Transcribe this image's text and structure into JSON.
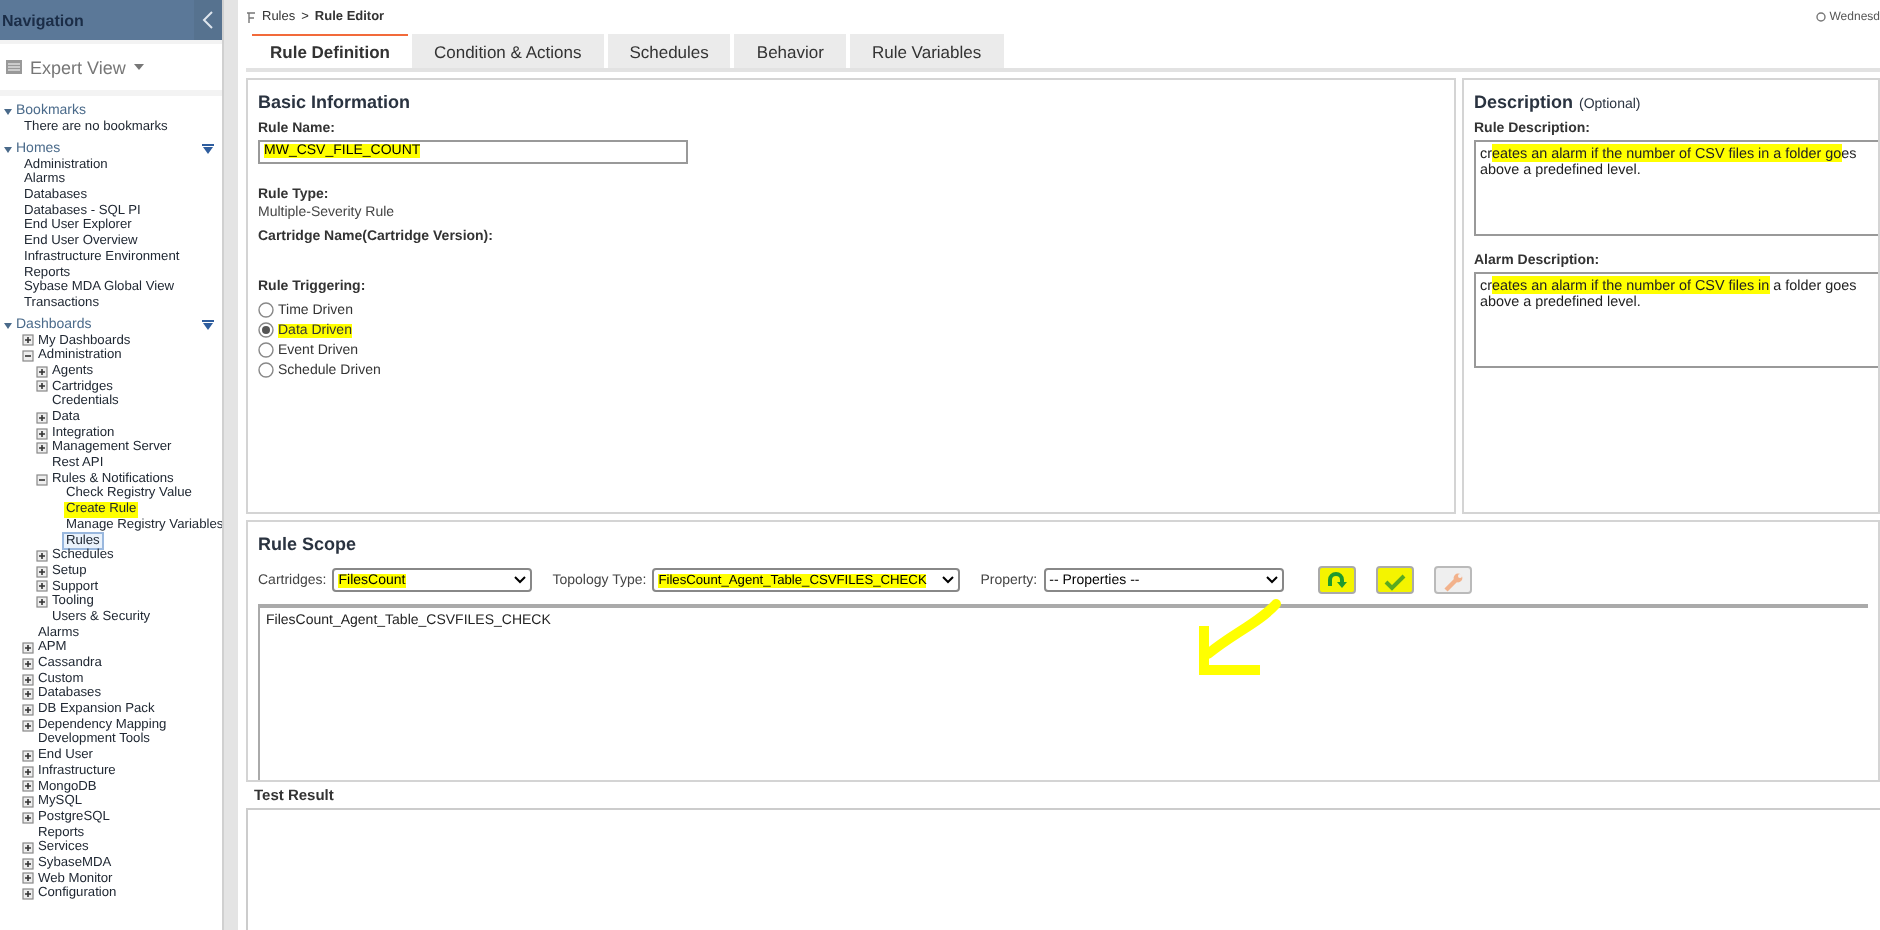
{
  "navigation": {
    "title": "Navigation",
    "view": "Expert View",
    "sections": [
      {
        "label": "Bookmarks",
        "expanded": true,
        "menu": false,
        "items": [
          {
            "label": "There are no bookmarks",
            "kind": "leaf",
            "selected": false,
            "highlighted": false
          }
        ]
      },
      {
        "label": "Homes",
        "expanded": true,
        "menu": true,
        "items": [
          {
            "label": "Administration",
            "kind": "leaf",
            "selected": false,
            "highlighted": false
          },
          {
            "label": "Alarms",
            "kind": "leaf",
            "selected": false,
            "highlighted": false
          },
          {
            "label": "Databases",
            "kind": "leaf",
            "selected": false,
            "highlighted": false
          },
          {
            "label": "Databases - SQL PI",
            "kind": "leaf",
            "selected": false,
            "highlighted": false
          },
          {
            "label": "End User Explorer",
            "kind": "leaf",
            "selected": false,
            "highlighted": false
          },
          {
            "label": "End User Overview",
            "kind": "leaf",
            "selected": false,
            "highlighted": false
          },
          {
            "label": "Infrastructure Environment",
            "kind": "leaf",
            "selected": false,
            "highlighted": false
          },
          {
            "label": "Reports",
            "kind": "leaf",
            "selected": false,
            "highlighted": false
          },
          {
            "label": "Sybase MDA Global View",
            "kind": "leaf",
            "selected": false,
            "highlighted": false
          },
          {
            "label": "Transactions",
            "kind": "leaf",
            "selected": false,
            "highlighted": false
          }
        ]
      },
      {
        "label": "Dashboards",
        "expanded": true,
        "menu": true,
        "items": [
          {
            "label": "My Dashboards",
            "kind": "branch",
            "expanded": false,
            "selected": false,
            "highlighted": false
          },
          {
            "label": "Administration",
            "kind": "branch",
            "expanded": true,
            "selected": false,
            "highlighted": false,
            "children": [
              {
                "label": "Agents",
                "kind": "branch",
                "expanded": false,
                "selected": false,
                "highlighted": false
              },
              {
                "label": "Cartridges",
                "kind": "branch",
                "expanded": false,
                "selected": false,
                "highlighted": false
              },
              {
                "label": "Credentials",
                "kind": "leaf",
                "selected": false,
                "highlighted": false
              },
              {
                "label": "Data",
                "kind": "branch",
                "expanded": false,
                "selected": false,
                "highlighted": false
              },
              {
                "label": "Integration",
                "kind": "branch",
                "expanded": false,
                "selected": false,
                "highlighted": false
              },
              {
                "label": "Management Server",
                "kind": "branch",
                "expanded": false,
                "selected": false,
                "highlighted": false
              },
              {
                "label": "Rest API",
                "kind": "leaf",
                "selected": false,
                "highlighted": false
              },
              {
                "label": "Rules & Notifications",
                "kind": "branch",
                "expanded": true,
                "selected": false,
                "highlighted": false,
                "children": [
                  {
                    "label": "Check Registry Value",
                    "kind": "leaf",
                    "selected": false,
                    "highlighted": false
                  },
                  {
                    "label": "Create Rule",
                    "kind": "leaf",
                    "selected": false,
                    "highlighted": true
                  },
                  {
                    "label": "Manage Registry Variables",
                    "kind": "leaf",
                    "selected": false,
                    "highlighted": false
                  },
                  {
                    "label": "Rules",
                    "kind": "leaf",
                    "selected": true,
                    "highlighted": false
                  }
                ]
              },
              {
                "label": "Schedules",
                "kind": "branch",
                "expanded": false,
                "selected": false,
                "highlighted": false
              },
              {
                "label": "Setup",
                "kind": "branch",
                "expanded": false,
                "selected": false,
                "highlighted": false
              },
              {
                "label": "Support",
                "kind": "branch",
                "expanded": false,
                "selected": false,
                "highlighted": false
              },
              {
                "label": "Tooling",
                "kind": "branch",
                "expanded": false,
                "selected": false,
                "highlighted": false
              },
              {
                "label": "Users & Security",
                "kind": "leaf",
                "selected": false,
                "highlighted": false
              }
            ]
          },
          {
            "label": "Alarms",
            "kind": "leaf",
            "selected": false,
            "highlighted": false
          },
          {
            "label": "APM",
            "kind": "branch",
            "expanded": false,
            "selected": false,
            "highlighted": false
          },
          {
            "label": "Cassandra",
            "kind": "branch",
            "expanded": false,
            "selected": false,
            "highlighted": false
          },
          {
            "label": "Custom",
            "kind": "branch",
            "expanded": false,
            "selected": false,
            "highlighted": false
          },
          {
            "label": "Databases",
            "kind": "branch",
            "expanded": false,
            "selected": false,
            "highlighted": false
          },
          {
            "label": "DB Expansion Pack",
            "kind": "branch",
            "expanded": false,
            "selected": false,
            "highlighted": false
          },
          {
            "label": "Dependency Mapping",
            "kind": "branch",
            "expanded": false,
            "selected": false,
            "highlighted": false
          },
          {
            "label": "Development Tools",
            "kind": "leaf",
            "selected": false,
            "highlighted": false
          },
          {
            "label": "End User",
            "kind": "branch",
            "expanded": false,
            "selected": false,
            "highlighted": false
          },
          {
            "label": "Infrastructure",
            "kind": "branch",
            "expanded": false,
            "selected": false,
            "highlighted": false
          },
          {
            "label": "MongoDB",
            "kind": "branch",
            "expanded": false,
            "selected": false,
            "highlighted": false
          },
          {
            "label": "MySQL",
            "kind": "branch",
            "expanded": false,
            "selected": false,
            "highlighted": false
          },
          {
            "label": "PostgreSQL",
            "kind": "branch",
            "expanded": false,
            "selected": false,
            "highlighted": false
          },
          {
            "label": "Reports",
            "kind": "leaf",
            "selected": false,
            "highlighted": false
          },
          {
            "label": "Services",
            "kind": "branch",
            "expanded": false,
            "selected": false,
            "highlighted": false
          },
          {
            "label": "SybaseMDA",
            "kind": "branch",
            "expanded": false,
            "selected": false,
            "highlighted": false
          },
          {
            "label": "Web Monitor",
            "kind": "branch",
            "expanded": false,
            "selected": false,
            "highlighted": false
          },
          {
            "label": "Configuration",
            "kind": "branch",
            "expanded": false,
            "selected": false,
            "highlighted": false
          }
        ]
      }
    ]
  },
  "breadcrumb": {
    "items": [
      "Rules",
      "Rule Editor"
    ],
    "separator": ">"
  },
  "date_text": "Wednesd",
  "tabs": [
    {
      "label": "Rule Definition",
      "selected": true
    },
    {
      "label": "Condition & Actions",
      "selected": false
    },
    {
      "label": "Schedules",
      "selected": false
    },
    {
      "label": "Behavior",
      "selected": false
    },
    {
      "label": "Rule Variables",
      "selected": false
    }
  ],
  "basic_information": {
    "title": "Basic Information",
    "rule_name": {
      "label": "Rule Name:",
      "value": "MW_CSV_FILE_COUNT",
      "highlighted": true
    },
    "rule_type": {
      "label": "Rule Type:",
      "value": "Multiple-Severity Rule"
    },
    "cartridge_name": {
      "label": "Cartridge Name(Cartridge Version):"
    },
    "rule_triggering": {
      "label": "Rule Triggering:",
      "options": [
        {
          "label": "Time Driven",
          "selected": false,
          "highlighted": false
        },
        {
          "label": "Data Driven",
          "selected": true,
          "highlighted": true
        },
        {
          "label": "Event Driven",
          "selected": false,
          "highlighted": false
        },
        {
          "label": "Schedule Driven",
          "selected": false,
          "highlighted": false
        }
      ]
    }
  },
  "description": {
    "title": "Description",
    "note": "(Optional)",
    "fields": [
      {
        "label": "Rule Description:",
        "segments": [
          {
            "text": "cr",
            "highlighted": false
          },
          {
            "text": "eates an alarm if the number of CSV files in a folder go",
            "highlighted": true
          },
          {
            "text": "es above a predefined level.",
            "highlighted": false
          }
        ]
      },
      {
        "label": "Alarm Description:",
        "segments": [
          {
            "text": "cr",
            "highlighted": false
          },
          {
            "text": "eates an alarm if the number of CSV files in",
            "highlighted": true
          },
          {
            "text": " a folder goes above a predefined level.",
            "highlighted": false
          }
        ]
      }
    ]
  },
  "rule_scope": {
    "title": "Rule Scope",
    "selects": [
      {
        "label": "Cartridges:",
        "value": "FilesCount",
        "highlighted": true
      },
      {
        "label": "Topology Type:",
        "value": "FilesCount_Agent_Table_CSVFILES_CHECK",
        "highlighted": true
      },
      {
        "label": "Property:",
        "value": "-- Properties --",
        "highlighted": false
      }
    ],
    "buttons": [
      {
        "kind": "arrow",
        "disabled": false,
        "highlighted": true
      },
      {
        "kind": "check",
        "disabled": false,
        "highlighted": true
      },
      {
        "kind": "wrench",
        "disabled": true,
        "highlighted": false
      }
    ],
    "scope_text": "FilesCount_Agent_Table_CSVFILES_CHECK"
  },
  "test_result": {
    "title": "Test Result"
  }
}
